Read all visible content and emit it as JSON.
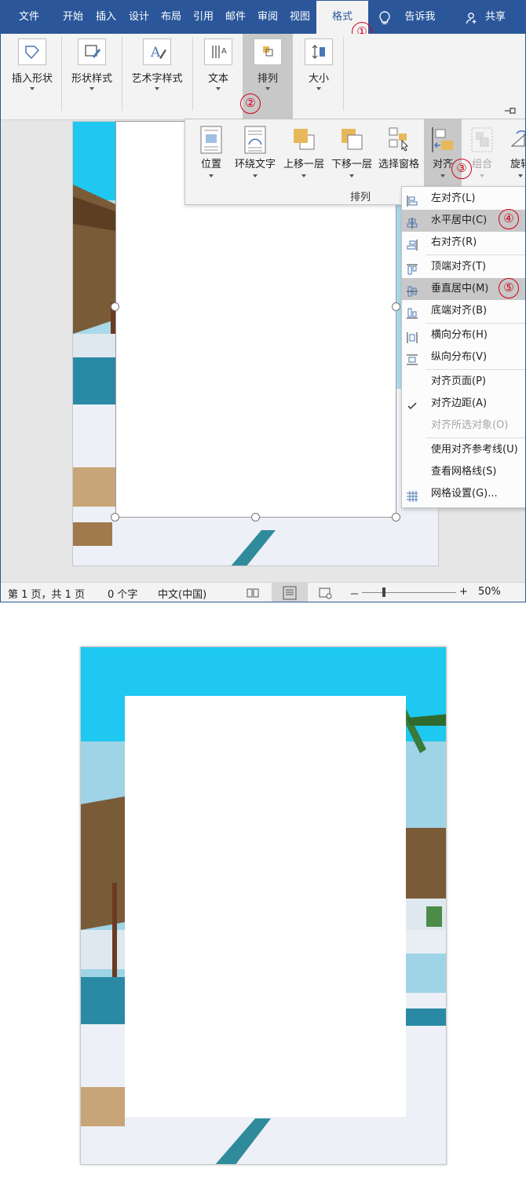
{
  "tabs": [
    {
      "label": "文件",
      "active": false
    },
    {
      "label": "开始",
      "active": false
    },
    {
      "label": "插入",
      "active": false
    },
    {
      "label": "设计",
      "active": false
    },
    {
      "label": "布局",
      "active": false
    },
    {
      "label": "引用",
      "active": false
    },
    {
      "label": "邮件",
      "active": false
    },
    {
      "label": "审阅",
      "active": false
    },
    {
      "label": "视图",
      "active": false
    },
    {
      "label": "格式",
      "active": true
    }
  ],
  "tellme": {
    "label": "告诉我",
    "icon": "lightbulb-icon"
  },
  "share": {
    "label": "共享",
    "icon": "person-add-icon"
  },
  "ribbon": {
    "groups": [
      {
        "label": "插入形状",
        "icon": "shapes-icon"
      },
      {
        "label": "形状样式",
        "icon": "shape-style-icon"
      },
      {
        "label": "艺术字样式",
        "icon": "wordart-icon"
      },
      {
        "label": "文本",
        "icon": "text-direction-icon"
      },
      {
        "label": "排列",
        "icon": "arrange-icon",
        "selected": true
      },
      {
        "label": "大小",
        "icon": "size-icon"
      }
    ]
  },
  "arrange": {
    "group_label": "排列",
    "buttons": [
      {
        "label": "位置",
        "icon": "position-icon"
      },
      {
        "label": "环绕文字",
        "icon": "wrap-text-icon"
      },
      {
        "label": "上移一层",
        "icon": "bring-forward-icon"
      },
      {
        "label": "下移一层",
        "icon": "send-backward-icon"
      },
      {
        "label": "选择窗格",
        "icon": "selection-pane-icon"
      },
      {
        "label": "对齐",
        "icon": "align-icon",
        "selected": true
      },
      {
        "label": "组合",
        "icon": "group-icon",
        "disabled": true
      },
      {
        "label": "旋转",
        "icon": "rotate-icon"
      }
    ]
  },
  "align_menu": [
    {
      "label": "左对齐(L)",
      "icon": "align-left-icon"
    },
    {
      "label": "水平居中(C)",
      "icon": "align-center-icon",
      "highlighted": true
    },
    {
      "label": "右对齐(R)",
      "icon": "align-right-icon"
    },
    {
      "label": "顶端对齐(T)",
      "icon": "align-top-icon"
    },
    {
      "label": "垂直居中(M)",
      "icon": "align-middle-icon",
      "highlighted": true
    },
    {
      "label": "底端对齐(B)",
      "icon": "align-bottom-icon"
    },
    {
      "label": "横向分布(H)",
      "icon": "distribute-horizontal-icon"
    },
    {
      "label": "纵向分布(V)",
      "icon": "distribute-vertical-icon"
    },
    {
      "label": "对齐页面(P)",
      "icon": ""
    },
    {
      "label": "对齐边距(A)",
      "icon": "checkmark-icon",
      "checked": true
    },
    {
      "label": "对齐所选对象(O)",
      "icon": "",
      "disabled": true
    },
    {
      "label": "使用对齐参考线(U)",
      "icon": ""
    },
    {
      "label": "查看网格线(S)",
      "icon": ""
    },
    {
      "label": "网格设置(G)...",
      "icon": "grid-icon"
    }
  ],
  "steps": [
    "①",
    "②",
    "③",
    "④",
    "⑤"
  ],
  "status": {
    "page": "第 1 页，共 1 页",
    "words": "0 个字",
    "language": "中文(中国)",
    "zoom": "50%",
    "zoom_minus": "－",
    "zoom_plus": "+"
  },
  "colors": {
    "brand": "#2b579a",
    "annotation": "#d0021b",
    "sky": "#1ec8f0"
  }
}
